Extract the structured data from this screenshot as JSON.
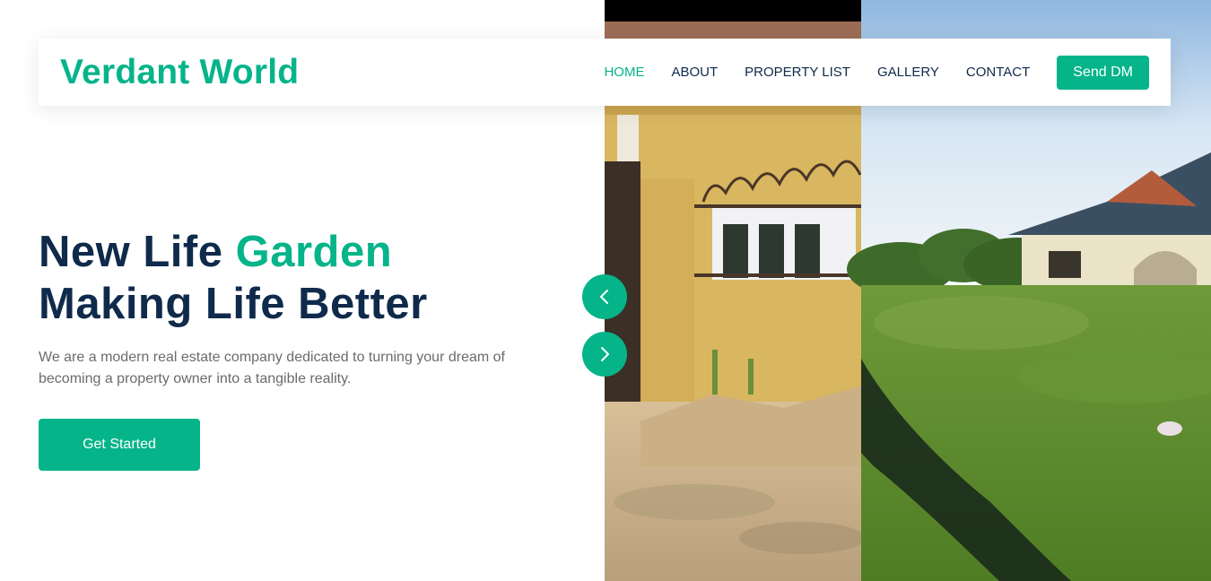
{
  "brand": {
    "name": "Verdant World"
  },
  "nav": {
    "items": [
      {
        "label": "HOME",
        "active": true
      },
      {
        "label": "ABOUT",
        "active": false
      },
      {
        "label": "PROPERTY LIST",
        "active": false
      },
      {
        "label": "GALLERY",
        "active": false
      },
      {
        "label": "CONTACT",
        "active": false
      }
    ],
    "send_dm_label": "Send DM"
  },
  "hero": {
    "title_line1_part1": "New Life ",
    "title_line1_accent": "Garden",
    "title_line2": "Making Life Better",
    "description": "We are a modern real estate company dedicated to turning your dream of becoming a property owner into a tangible reality.",
    "cta_label": "Get Started"
  },
  "carousel": {
    "prev_icon": "chevron-left-icon",
    "next_icon": "chevron-right-icon",
    "images": [
      "yellow-fenced-house-photo",
      "bungalow-in-green-field-photo"
    ]
  },
  "colors": {
    "accent": "#06B48A",
    "navy": "#0F2A4A",
    "text_muted": "#6b6b6b"
  }
}
